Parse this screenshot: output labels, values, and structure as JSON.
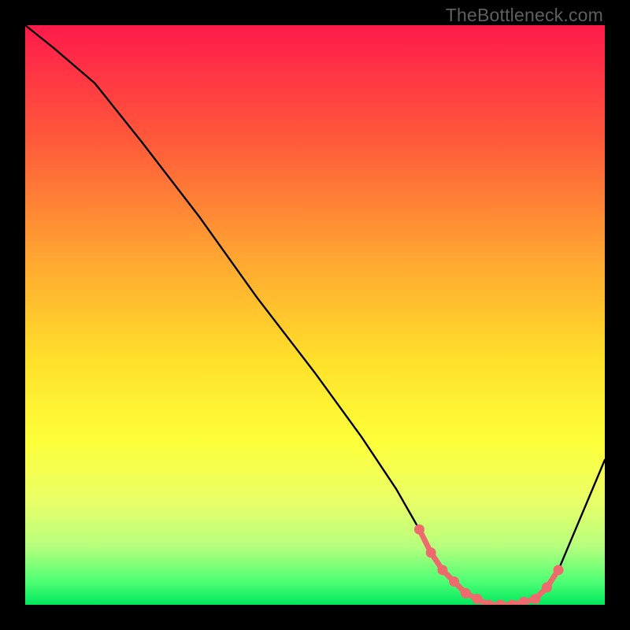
{
  "watermark": "TheBottleneck.com",
  "chart_data": {
    "type": "line",
    "title": "",
    "xlabel": "",
    "ylabel": "",
    "xlim": [
      0,
      100
    ],
    "ylim": [
      0,
      100
    ],
    "grid": false,
    "legend": false,
    "gradient_stops": [
      {
        "offset": 0.0,
        "color": "#ff1a4b"
      },
      {
        "offset": 0.2,
        "color": "#ff5a3a"
      },
      {
        "offset": 0.4,
        "color": "#ffa531"
      },
      {
        "offset": 0.58,
        "color": "#ffe12a"
      },
      {
        "offset": 0.72,
        "color": "#fdff3a"
      },
      {
        "offset": 0.82,
        "color": "#eaff67"
      },
      {
        "offset": 0.9,
        "color": "#b6ff7e"
      },
      {
        "offset": 0.96,
        "color": "#4eff74"
      },
      {
        "offset": 1.0,
        "color": "#00e85e"
      }
    ],
    "curve": {
      "x": [
        0,
        5,
        12,
        20,
        30,
        40,
        50,
        58,
        64,
        68,
        72,
        76,
        80,
        84,
        88,
        92,
        100
      ],
      "y": [
        100,
        96,
        90,
        80,
        67,
        53,
        40,
        29,
        20,
        13,
        6,
        2,
        0,
        0,
        1,
        6,
        25
      ]
    },
    "marker_region": {
      "x": [
        68,
        70,
        72,
        74,
        76,
        78,
        80,
        82,
        84,
        86,
        88,
        90,
        92
      ],
      "y": [
        13,
        9,
        6,
        4,
        2,
        1,
        0,
        0,
        0,
        0.5,
        1,
        3,
        6
      ]
    },
    "marker_color": "#ed6a6d",
    "line_color": "#000000"
  }
}
